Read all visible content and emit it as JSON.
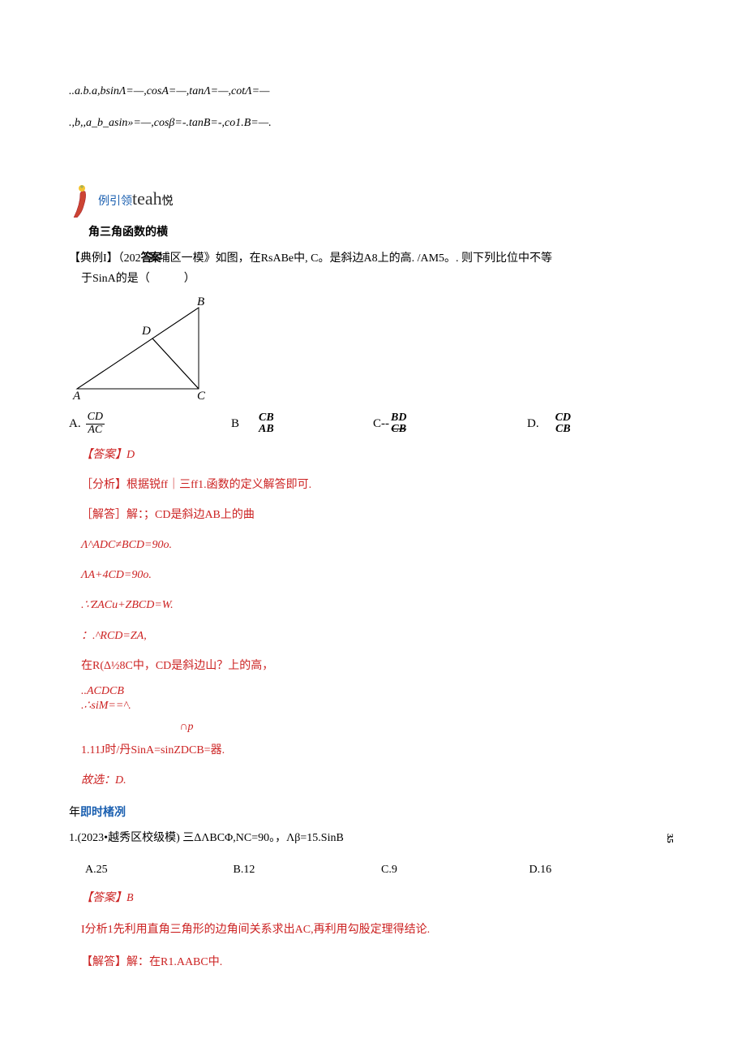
{
  "top": {
    "line1": "..a.b.a,bsinΛ=—,cosA=—,tanΛ=—,cotΛ=—",
    "line2": ".,b,,a_b_asin»=—,cosβ=-.tanB=-,co1.B=—."
  },
  "emblem": {
    "text_prefix": "例引领",
    "text_main": "teah",
    "text_suffix": "悦"
  },
  "heading": "角三角函数的横",
  "q1": {
    "prefix": "【典例I】（202",
    "cramped": "答案",
    "mid": "埔区一模》如图，在RsABe中, C。是斜边A8上的高. /AM5。. 则下列比位中不等",
    "line2": "于SinA的是（　　　）"
  },
  "options": {
    "A": {
      "label": "A.",
      "num": "CD",
      "den": "AC"
    },
    "B": {
      "label": "B",
      "num": "CB",
      "den": "AB"
    },
    "C": {
      "label": "C--",
      "num": "BD",
      "den": "CB"
    },
    "D": {
      "label": "D.",
      "num": "CD",
      "den": "CB"
    }
  },
  "solution": {
    "ans_label": "【答案】",
    "ans_val": "D",
    "analysis": "［分析】根据锐ff｜三ff1.函数的定义解答即可.",
    "steps": [
      "［解答］解：；CD是斜边AB上的曲",
      "Λ^ADC≠BCD=90o.",
      "ΛA+4CD=90o.",
      ".∵ZACu+ZBCD=W.",
      "：.^RCD=ZA,",
      "在R(Δ½8C中，CD是斜边山？上的高，",
      "..ACDCB",
      ".∴siM==^.",
      "∩p",
      "1.11J时/丹SinA=sinZDCB=器.",
      "故选：D."
    ]
  },
  "practice": {
    "prefix": "年",
    "label": "即时楮冽"
  },
  "q2": {
    "text": "1.(2023•越秀区校级模) 三ΔΛBCΦ,NC=90。，Λβ=15.SinB",
    "side": "3.5",
    "options": {
      "A": "A.25",
      "B": "B.12",
      "C": "C.9",
      "D": "D.16"
    },
    "ans_label": "【答案】",
    "ans_val": "B",
    "analysis": "I分析1先利用直角三角形的边角间关系求出AC,再利用勾股定理得结论.",
    "explain": "【解答】解：在R1.AABC中."
  }
}
